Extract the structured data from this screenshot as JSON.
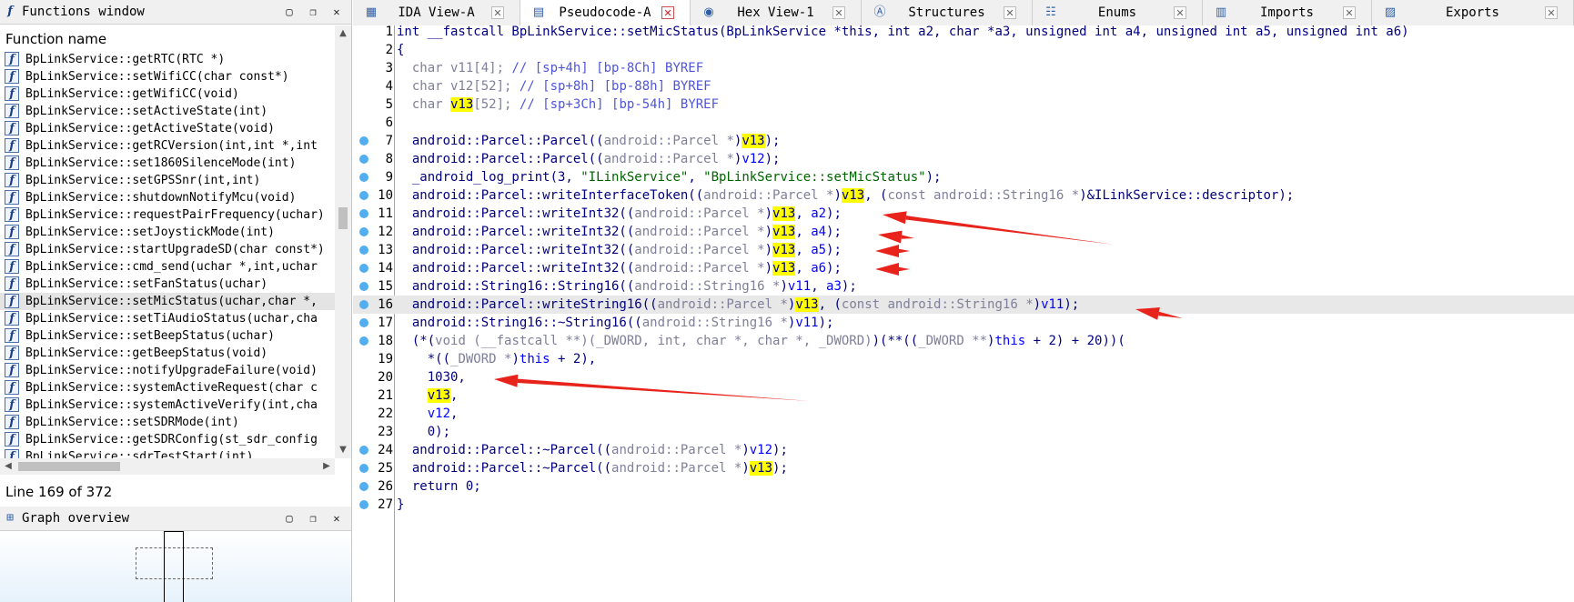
{
  "functions_window": {
    "title": "Functions window",
    "column_header": "Function name",
    "status": "Line 169 of 372",
    "items": [
      "BpLinkService::getRTC(RTC *)",
      "BpLinkService::setWifiCC(char const*)",
      "BpLinkService::getWifiCC(void)",
      "BpLinkService::setActiveState(int)",
      "BpLinkService::getActiveState(void)",
      "BpLinkService::getRCVersion(int,int *,int",
      "BpLinkService::set1860SilenceMode(int)",
      "BpLinkService::setGPSSnr(int,int)",
      "BpLinkService::shutdownNotifyMcu(void)",
      "BpLinkService::requestPairFrequency(uchar)",
      "BpLinkService::setJoystickMode(int)",
      "BpLinkService::startUpgradeSD(char const*)",
      "BpLinkService::cmd_send(uchar *,int,uchar",
      "BpLinkService::setFanStatus(uchar)",
      "BpLinkService::setMicStatus(uchar,char *,",
      "BpLinkService::setTiAudioStatus(uchar,cha",
      "BpLinkService::setBeepStatus(uchar)",
      "BpLinkService::getBeepStatus(void)",
      "BpLinkService::notifyUpgradeFailure(void)",
      "BpLinkService::systemActiveRequest(char c",
      "BpLinkService::systemActiveVerify(int,cha",
      "BpLinkService::setSDRMode(int)",
      "BpLinkService::getSDRConfig(st_sdr_config",
      "BpLinkService::sdrTestStart(int)"
    ],
    "selected_index": 14
  },
  "graph_overview": {
    "title": "Graph overview"
  },
  "tabs": [
    {
      "label": "IDA View-A",
      "icon": "ida-view-icon",
      "active": false
    },
    {
      "label": "Pseudocode-A",
      "icon": "pseudocode-icon",
      "active": true
    },
    {
      "label": "Hex View-1",
      "icon": "hex-view-icon",
      "active": false
    },
    {
      "label": "Structures",
      "icon": "structures-icon",
      "active": false
    },
    {
      "label": "Enums",
      "icon": "enums-icon",
      "active": false
    },
    {
      "label": "Imports",
      "icon": "imports-icon",
      "active": false
    },
    {
      "label": "Exports",
      "icon": "exports-icon",
      "active": false
    }
  ],
  "code": {
    "current_line": 16,
    "lines": [
      {
        "n": "1",
        "dot": false,
        "indent": "",
        "tokens": [
          [
            "t",
            "int __fastcall BpLinkService::setMicStatus(BpLinkService *this, int a2, char *a3, unsigned int a4, unsigned int a5, unsigned int a6)"
          ]
        ]
      },
      {
        "n": "2",
        "dot": false,
        "indent": "",
        "tokens": [
          [
            "t",
            "{"
          ]
        ]
      },
      {
        "n": "3",
        "dot": false,
        "indent": "  ",
        "tokens": [
          [
            "g",
            "char v11[4]; "
          ],
          [
            "c",
            "// [sp+4h] [bp-8Ch] BYREF"
          ]
        ]
      },
      {
        "n": "4",
        "dot": false,
        "indent": "  ",
        "tokens": [
          [
            "g",
            "char v12[52]; "
          ],
          [
            "c",
            "// [sp+8h] [bp-88h] BYREF"
          ]
        ]
      },
      {
        "n": "5",
        "dot": false,
        "indent": "  ",
        "tokens": [
          [
            "g",
            "char "
          ],
          [
            "h",
            "v13"
          ],
          [
            "g",
            "[52]; "
          ],
          [
            "c",
            "// [sp+3Ch] [bp-54h] BYREF"
          ]
        ]
      },
      {
        "n": "6",
        "dot": false,
        "indent": "",
        "tokens": []
      },
      {
        "n": "7",
        "dot": true,
        "indent": "  ",
        "tokens": [
          [
            "t",
            "android::Parcel::Parcel(("
          ],
          [
            "g",
            "android::Parcel *"
          ],
          [
            "t",
            ")"
          ],
          [
            "h",
            "v13"
          ],
          [
            "t",
            ");"
          ]
        ]
      },
      {
        "n": "8",
        "dot": true,
        "indent": "  ",
        "tokens": [
          [
            "t",
            "android::Parcel::Parcel(("
          ],
          [
            "g",
            "android::Parcel *"
          ],
          [
            "t",
            ")"
          ],
          [
            "v",
            "v12"
          ],
          [
            "t",
            ");"
          ]
        ]
      },
      {
        "n": "9",
        "dot": true,
        "indent": "  ",
        "tokens": [
          [
            "t",
            "_android_log_print(3, "
          ],
          [
            "s",
            "\"ILinkService\""
          ],
          [
            "t",
            ", "
          ],
          [
            "s",
            "\"BpLinkService::setMicStatus\""
          ],
          [
            "t",
            ");"
          ]
        ]
      },
      {
        "n": "10",
        "dot": true,
        "indent": "  ",
        "tokens": [
          [
            "t",
            "android::Parcel::writeInterfaceToken(("
          ],
          [
            "g",
            "android::Parcel *"
          ],
          [
            "t",
            ")"
          ],
          [
            "h",
            "v13"
          ],
          [
            "t",
            ", ("
          ],
          [
            "g",
            "const android::String16 *"
          ],
          [
            "t",
            ")&ILinkService::descriptor);"
          ]
        ]
      },
      {
        "n": "11",
        "dot": true,
        "indent": "  ",
        "tokens": [
          [
            "t",
            "android::Parcel::writeInt32(("
          ],
          [
            "g",
            "android::Parcel *"
          ],
          [
            "t",
            ")"
          ],
          [
            "h",
            "v13"
          ],
          [
            "t",
            ", "
          ],
          [
            "v",
            "a2"
          ],
          [
            "t",
            ");"
          ]
        ]
      },
      {
        "n": "12",
        "dot": true,
        "indent": "  ",
        "tokens": [
          [
            "t",
            "android::Parcel::writeInt32(("
          ],
          [
            "g",
            "android::Parcel *"
          ],
          [
            "t",
            ")"
          ],
          [
            "h",
            "v13"
          ],
          [
            "t",
            ", "
          ],
          [
            "v",
            "a4"
          ],
          [
            "t",
            ");"
          ]
        ]
      },
      {
        "n": "13",
        "dot": true,
        "indent": "  ",
        "tokens": [
          [
            "t",
            "android::Parcel::writeInt32(("
          ],
          [
            "g",
            "android::Parcel *"
          ],
          [
            "t",
            ")"
          ],
          [
            "h",
            "v13"
          ],
          [
            "t",
            ", "
          ],
          [
            "v",
            "a5"
          ],
          [
            "t",
            ");"
          ]
        ]
      },
      {
        "n": "14",
        "dot": true,
        "indent": "  ",
        "tokens": [
          [
            "t",
            "android::Parcel::writeInt32(("
          ],
          [
            "g",
            "android::Parcel *"
          ],
          [
            "t",
            ")"
          ],
          [
            "h",
            "v13"
          ],
          [
            "t",
            ", "
          ],
          [
            "v",
            "a6"
          ],
          [
            "t",
            ");"
          ]
        ]
      },
      {
        "n": "15",
        "dot": true,
        "indent": "  ",
        "tokens": [
          [
            "t",
            "android::String16::String16(("
          ],
          [
            "g",
            "android::String16 *"
          ],
          [
            "t",
            ")"
          ],
          [
            "v",
            "v11"
          ],
          [
            "t",
            ", "
          ],
          [
            "v",
            "a3"
          ],
          [
            "t",
            ");"
          ]
        ]
      },
      {
        "n": "16",
        "dot": true,
        "indent": "  ",
        "tokens": [
          [
            "t",
            "android::Parcel::writeString16(("
          ],
          [
            "g",
            "android::Parcel *"
          ],
          [
            "t",
            ")"
          ],
          [
            "h",
            "v13"
          ],
          [
            "t",
            ", ("
          ],
          [
            "g",
            "const android::String16 *"
          ],
          [
            "t",
            ")"
          ],
          [
            "v",
            "v11"
          ],
          [
            "t",
            ");"
          ]
        ]
      },
      {
        "n": "17",
        "dot": true,
        "indent": "  ",
        "tokens": [
          [
            "t",
            "android::String16::~String16(("
          ],
          [
            "g",
            "android::String16 *"
          ],
          [
            "t",
            ")"
          ],
          [
            "v",
            "v11"
          ],
          [
            "t",
            ");"
          ]
        ]
      },
      {
        "n": "18",
        "dot": true,
        "indent": "  ",
        "tokens": [
          [
            "t",
            "(*("
          ],
          [
            "g",
            "void (__fastcall **)(_DWORD, int, char *, char *, _DWORD)"
          ],
          [
            "t",
            ")(**(("
          ],
          [
            "g",
            "_DWORD **"
          ],
          [
            "t",
            ")"
          ],
          [
            "v",
            "this"
          ],
          [
            "t",
            " + 2) + 20))("
          ]
        ]
      },
      {
        "n": "19",
        "dot": false,
        "indent": "    ",
        "tokens": [
          [
            "t",
            "*(("
          ],
          [
            "g",
            "_DWORD *"
          ],
          [
            "t",
            ")"
          ],
          [
            "v",
            "this"
          ],
          [
            "t",
            " + 2),"
          ]
        ]
      },
      {
        "n": "20",
        "dot": false,
        "indent": "    ",
        "tokens": [
          [
            "t",
            "1030,"
          ]
        ]
      },
      {
        "n": "21",
        "dot": false,
        "indent": "    ",
        "tokens": [
          [
            "h",
            "v13"
          ],
          [
            "t",
            ","
          ]
        ]
      },
      {
        "n": "22",
        "dot": false,
        "indent": "    ",
        "tokens": [
          [
            "v",
            "v12"
          ],
          [
            "t",
            ","
          ]
        ]
      },
      {
        "n": "23",
        "dot": false,
        "indent": "    ",
        "tokens": [
          [
            "t",
            "0);"
          ]
        ]
      },
      {
        "n": "24",
        "dot": true,
        "indent": "  ",
        "tokens": [
          [
            "t",
            "android::Parcel::~Parcel(("
          ],
          [
            "g",
            "android::Parcel *"
          ],
          [
            "t",
            ")"
          ],
          [
            "v",
            "v12"
          ],
          [
            "t",
            ");"
          ]
        ]
      },
      {
        "n": "25",
        "dot": true,
        "indent": "  ",
        "tokens": [
          [
            "t",
            "android::Parcel::~Parcel(("
          ],
          [
            "g",
            "android::Parcel *"
          ],
          [
            "t",
            ")"
          ],
          [
            "h",
            "v13"
          ],
          [
            "t",
            ");"
          ]
        ]
      },
      {
        "n": "26",
        "dot": true,
        "indent": "  ",
        "tokens": [
          [
            "t",
            "return 0;"
          ]
        ]
      },
      {
        "n": "27",
        "dot": true,
        "indent": "",
        "tokens": [
          [
            "t",
            "}"
          ]
        ]
      }
    ]
  },
  "annotation_color": "#e8231b",
  "highlight_color": "#ffff00"
}
